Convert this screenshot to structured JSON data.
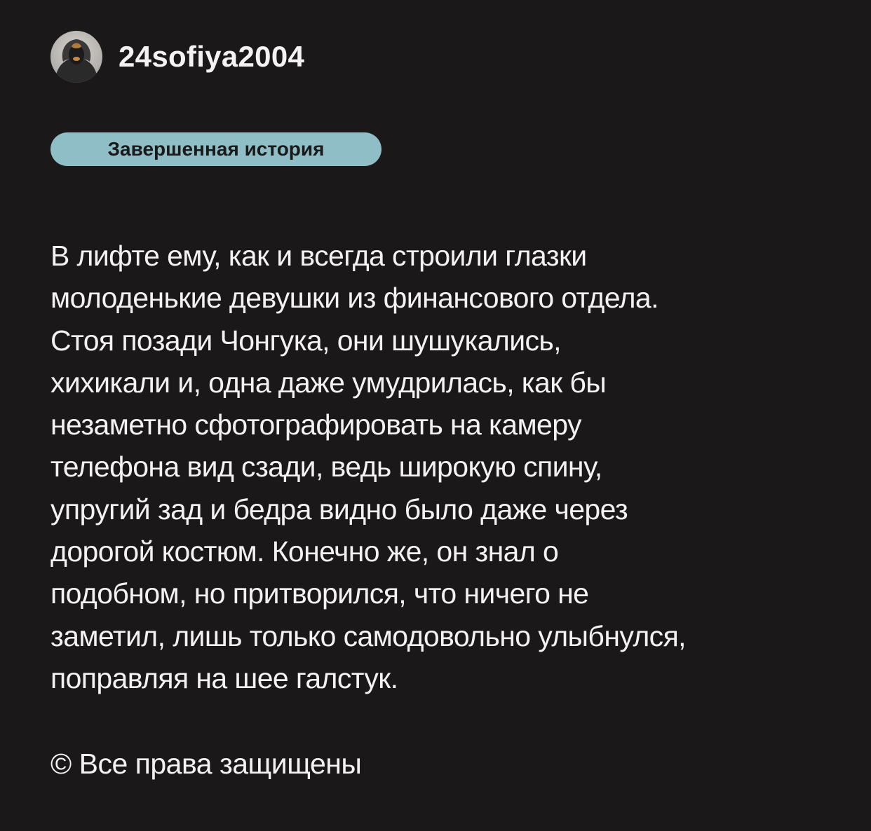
{
  "author": {
    "username": "24sofiya2004",
    "avatar_icon": "user-avatar-photo"
  },
  "status_badge": {
    "label": "Завершенная история",
    "color": "#8fbec6"
  },
  "story": {
    "lines": [
      "В лифте ему, как и всегда строили глазки",
      "молоденькие девушки из финансового отдела.",
      "Стоя позади Чонгука, они шушукались,",
      "хихикали и, одна даже умудрилась, как бы",
      "незаметно сфотографировать на камеру",
      "телефона вид сзади, ведь широкую спину,",
      "упругий зад и бедра видно было даже через",
      "дорогой костюм. Конечно же, он знал о",
      "подобном, но притворился, что ничего не",
      "заметил, лишь только самодовольно улыбнулся,",
      "поправляя на шее галстук."
    ]
  },
  "footer": {
    "copyright": "© Все права защищены"
  },
  "colors": {
    "background": "#1a1819",
    "text": "#f3f1f2"
  }
}
